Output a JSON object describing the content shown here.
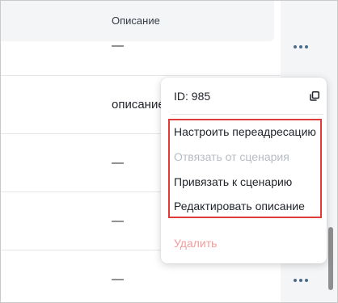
{
  "table": {
    "column_title": "Описание",
    "rows": [
      {
        "description": "—"
      },
      {
        "description": "описание"
      },
      {
        "description": "—"
      },
      {
        "description": "—"
      },
      {
        "description": "—"
      }
    ]
  },
  "menu": {
    "id_label": "ID: 985",
    "items": [
      {
        "label": "Настроить переадресацию",
        "state": "enabled"
      },
      {
        "label": "Отвязать от сценария",
        "state": "disabled"
      },
      {
        "label": "Привязать к сценарию",
        "state": "enabled"
      },
      {
        "label": "Редактировать описание",
        "state": "enabled"
      }
    ],
    "delete_label": "Удалить"
  },
  "icons": {
    "row_actions": "more-horizontal-icon",
    "copy": "copy-icon"
  },
  "colors": {
    "highlight": "#e03b3b",
    "danger_text": "#f29b9b",
    "disabled_text": "#b7bcc4",
    "dots": "#4a6b8a"
  }
}
